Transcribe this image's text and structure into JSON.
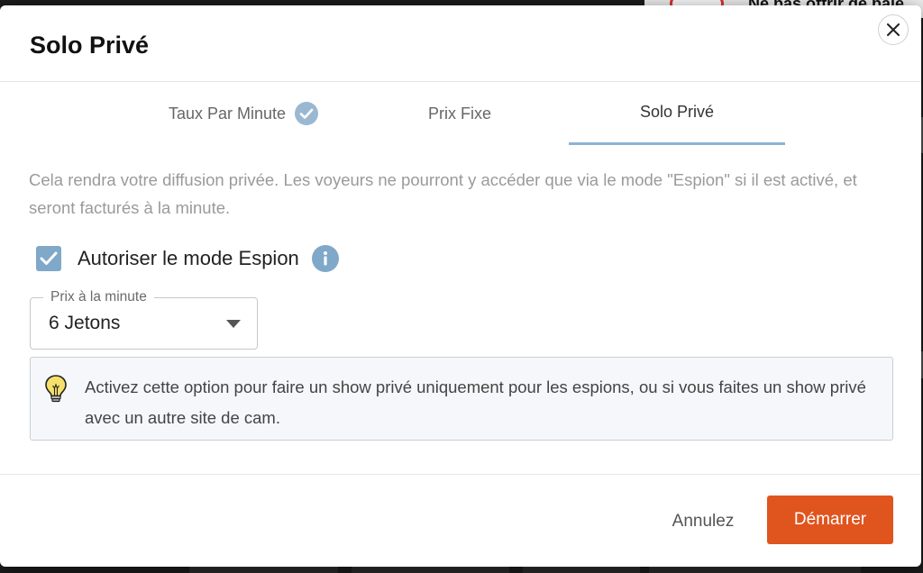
{
  "background": {
    "banner_text": "Ne pas offrir de paie"
  },
  "modal": {
    "title": "Solo Privé"
  },
  "tabs": [
    {
      "label": "Taux Par Minute",
      "completed": true,
      "active": false
    },
    {
      "label": "Prix Fixe",
      "completed": false,
      "active": false
    },
    {
      "label": "Solo Privé",
      "completed": false,
      "active": true
    }
  ],
  "description": "Cela rendra votre diffusion privée. Les voyeurs ne pourront y accéder que via le mode \"Espion\" si il est activé, et seront facturés à la minute.",
  "spy_mode": {
    "label": "Autoriser le mode Espion",
    "checked": true
  },
  "price_select": {
    "legend": "Prix à la minute",
    "value": "6 Jetons"
  },
  "hint": {
    "text": "Activez cette option pour faire un show privé uniquement pour les espions, ou si vous faites un show privé avec un autre site de cam."
  },
  "footer": {
    "cancel_label": "Annulez",
    "start_label": "Démarrer"
  },
  "colors": {
    "accent": "#7fa8c9",
    "primary_button": "#e0541e",
    "hint_background": "#f5f7fb"
  }
}
